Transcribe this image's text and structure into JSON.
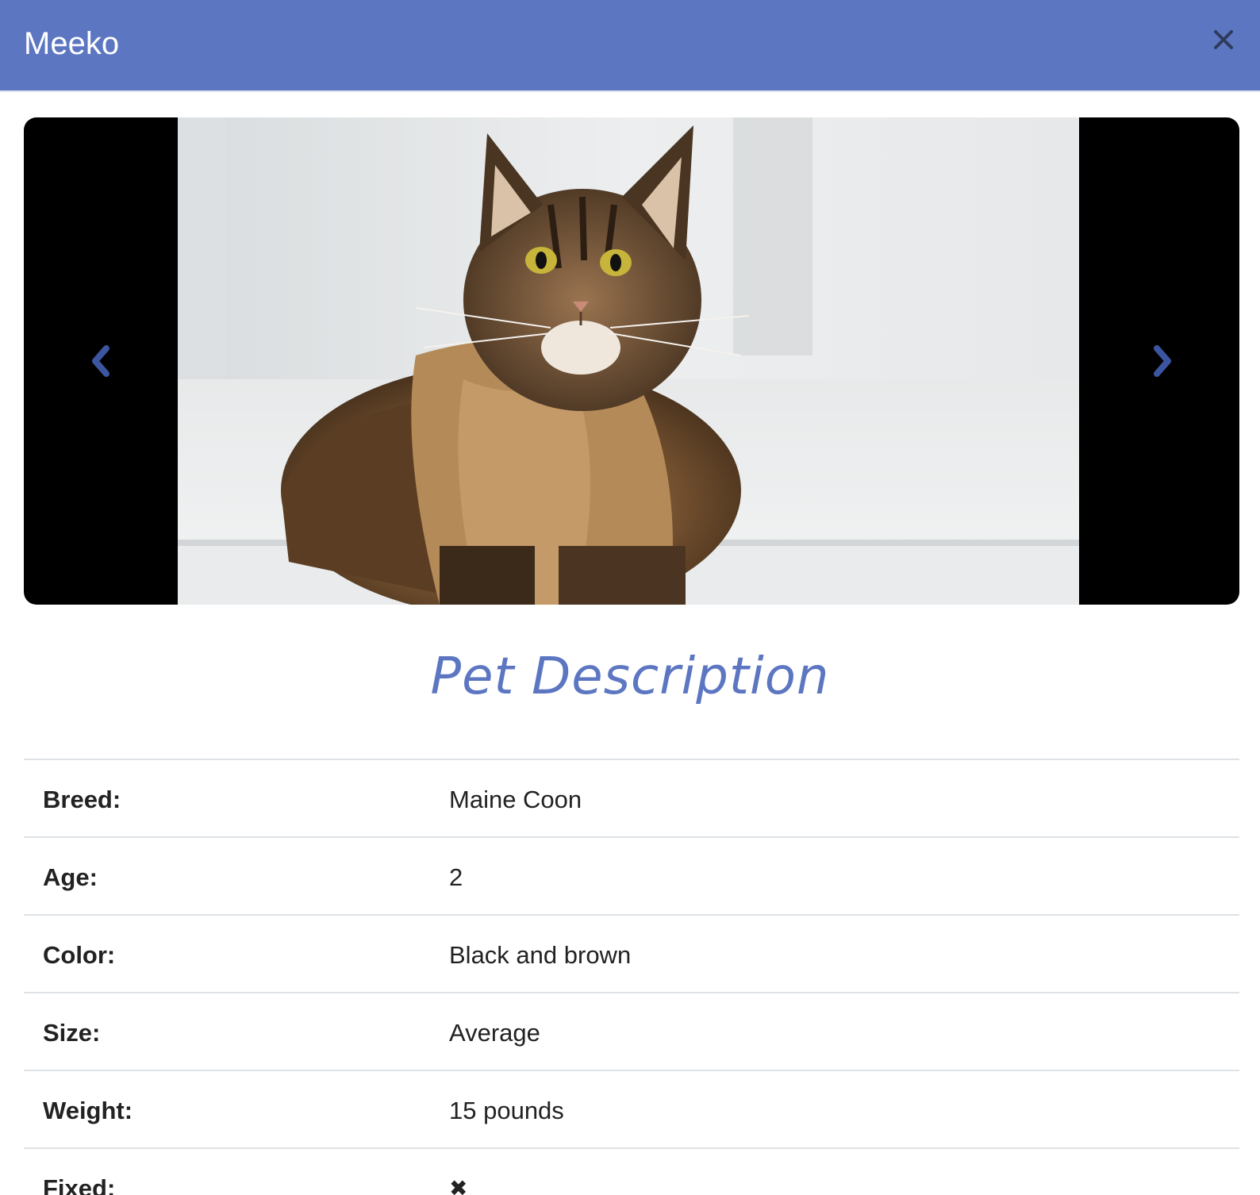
{
  "modal": {
    "title": "Meeko",
    "close_icon": "close-icon",
    "header_color": "#5c76c2"
  },
  "carousel": {
    "image_alt": "Maine Coon cat lying on a white floor",
    "prev_icon": "chevron-left-icon",
    "next_icon": "chevron-right-icon"
  },
  "section": {
    "title": "Pet Description"
  },
  "details": [
    {
      "label": "Breed:",
      "value": "Maine Coon"
    },
    {
      "label": "Age:",
      "value": "2"
    },
    {
      "label": "Color:",
      "value": "Black and brown"
    },
    {
      "label": "Size:",
      "value": "Average"
    },
    {
      "label": "Weight:",
      "value": "15 pounds"
    },
    {
      "label": "Fixed:",
      "value": "✖"
    }
  ]
}
